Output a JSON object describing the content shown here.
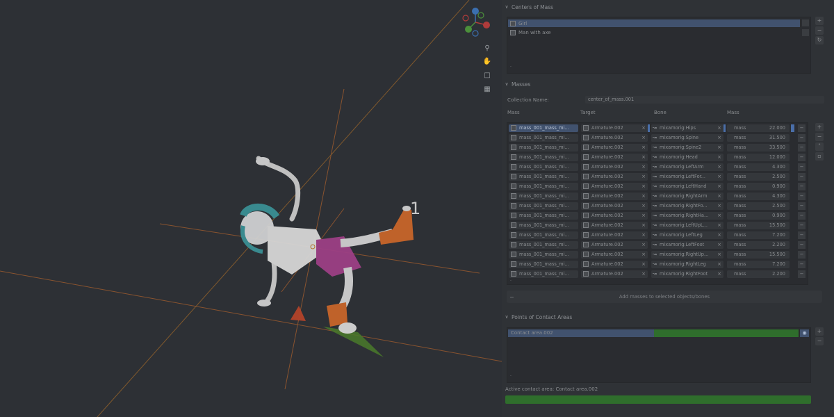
{
  "viewport": {
    "frame_number": "1",
    "gizmo_axes": [
      "Z",
      "Y",
      "X"
    ],
    "tools": [
      "zoom-icon",
      "hand-pan-icon",
      "camera-icon",
      "grid-icon"
    ]
  },
  "centers_of_mass": {
    "title": "Centers of Mass",
    "items": [
      {
        "label": "Girl",
        "selected": true
      },
      {
        "label": "Man with axe",
        "selected": false
      }
    ]
  },
  "masses": {
    "title": "Masses",
    "collection_label": "Collection Name:",
    "collection_value": "center_of_mass.001",
    "columns": [
      "Mass",
      "Target",
      "Bone",
      "Mass"
    ],
    "rows": [
      {
        "mass": "mass_001_mass_mi...",
        "target": "Armature.002",
        "bone": "mixamorig:Hips",
        "label": "mass",
        "value": "22.000",
        "selected": true
      },
      {
        "mass": "mass_001_mass_mi...",
        "target": "Armature.002",
        "bone": "mixamorig:Spine",
        "label": "mass",
        "value": "31.500"
      },
      {
        "mass": "mass_001_mass_mi...",
        "target": "Armature.002",
        "bone": "mixamorig:Spine2",
        "label": "mass",
        "value": "33.500"
      },
      {
        "mass": "mass_001_mass_mi...",
        "target": "Armature.002",
        "bone": "mixamorig:Head",
        "label": "mass",
        "value": "12.000"
      },
      {
        "mass": "mass_001_mass_mi...",
        "target": "Armature.002",
        "bone": "mixamorig:LeftArm",
        "label": "mass",
        "value": "4.300"
      },
      {
        "mass": "mass_001_mass_mi...",
        "target": "Armature.002",
        "bone": "mixamorig:LeftFor...",
        "label": "mass",
        "value": "2.500"
      },
      {
        "mass": "mass_001_mass_mi...",
        "target": "Armature.002",
        "bone": "mixamorig:LeftHand",
        "label": "mass",
        "value": "0.900"
      },
      {
        "mass": "mass_001_mass_mi...",
        "target": "Armature.002",
        "bone": "mixamorig:RightArm",
        "label": "mass",
        "value": "4.300"
      },
      {
        "mass": "mass_001_mass_mi...",
        "target": "Armature.002",
        "bone": "mixamorig:RightFo...",
        "label": "mass",
        "value": "2.500"
      },
      {
        "mass": "mass_001_mass_mi...",
        "target": "Armature.002",
        "bone": "mixamorig:RightHa...",
        "label": "mass",
        "value": "0.900"
      },
      {
        "mass": "mass_001_mass_mi...",
        "target": "Armature.002",
        "bone": "mixamorig:LeftUpL...",
        "label": "mass",
        "value": "15.500"
      },
      {
        "mass": "mass_001_mass_mi...",
        "target": "Armature.002",
        "bone": "mixamorig:LeftLeg",
        "label": "mass",
        "value": "7.200"
      },
      {
        "mass": "mass_001_mass_mi...",
        "target": "Armature.002",
        "bone": "mixamorig:LeftFoot",
        "label": "mass",
        "value": "2.200"
      },
      {
        "mass": "mass_001_mass_mi...",
        "target": "Armature.002",
        "bone": "mixamorig:RightUp...",
        "label": "mass",
        "value": "15.500"
      },
      {
        "mass": "mass_001_mass_mi...",
        "target": "Armature.002",
        "bone": "mixamorig:RightLeg",
        "label": "mass",
        "value": "7.200"
      },
      {
        "mass": "mass_001_mass_mi...",
        "target": "Armature.002",
        "bone": "mixamorig:RightFoot",
        "label": "mass",
        "value": "2.200"
      }
    ],
    "add_button": "Add masses to selected objects/bones"
  },
  "contact": {
    "title": "Points of Contact Areas",
    "items": [
      {
        "label": "Contact area.002",
        "selected": true
      }
    ],
    "active_label": "Active contact area: Contact area.002"
  },
  "colors": {
    "selection": "#41526e",
    "green": "#2f6e2c",
    "axis_orange": "#b5562a"
  }
}
